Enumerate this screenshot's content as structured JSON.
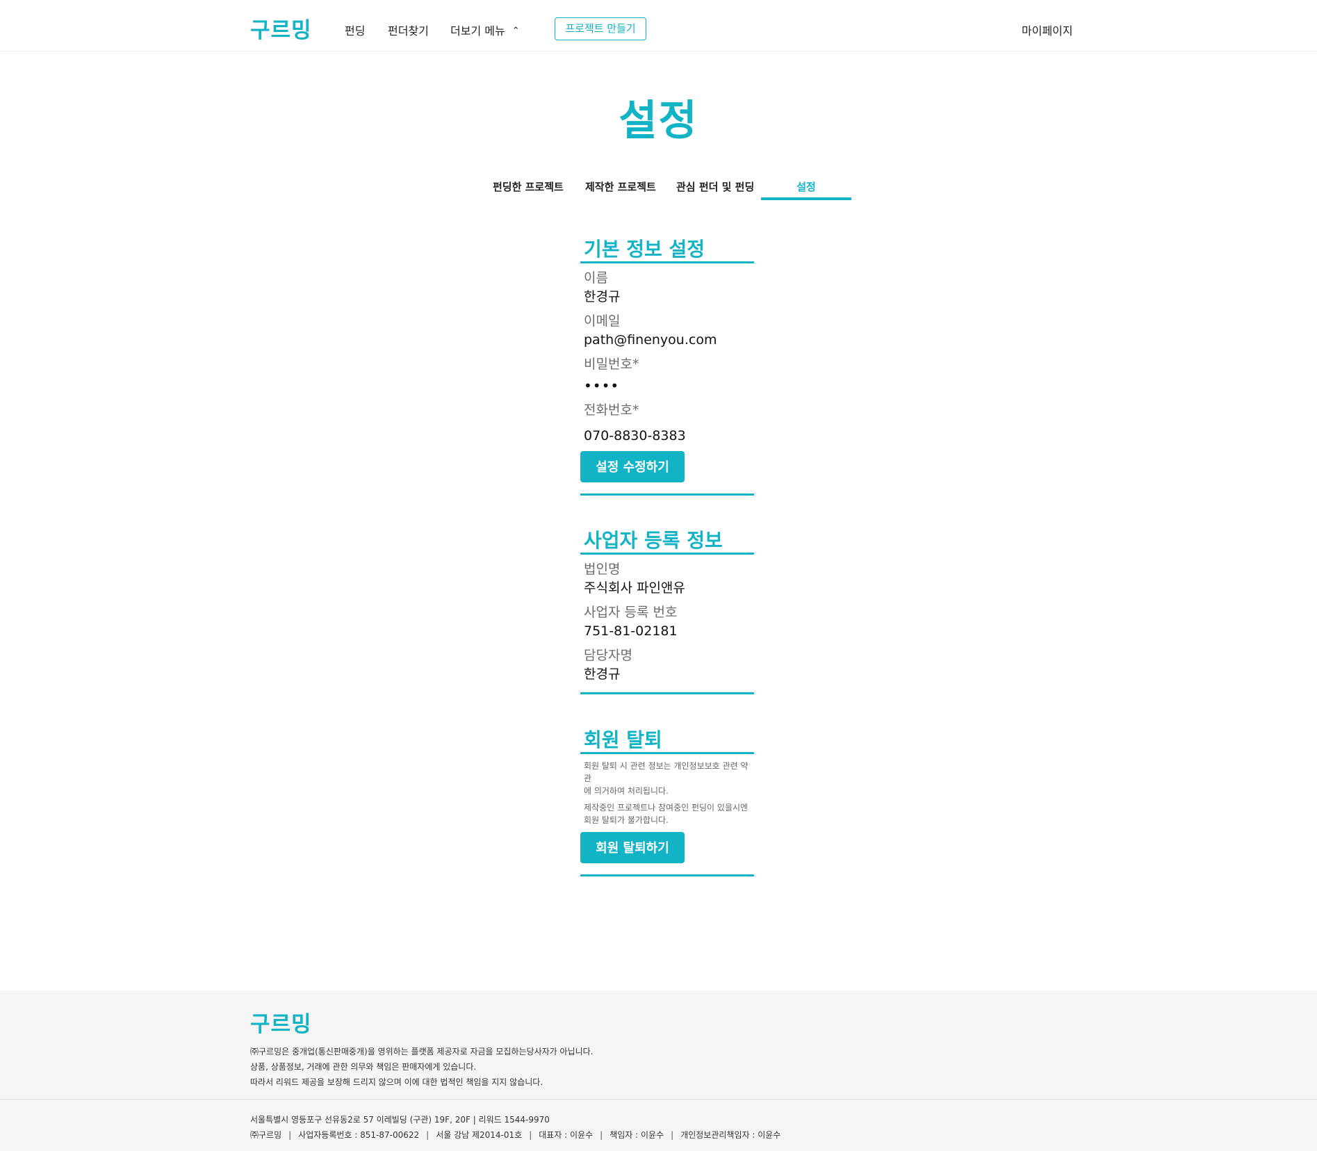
{
  "header": {
    "logo": "구르밍",
    "nav": {
      "funding": "펀딩",
      "funder": "펀더찾기",
      "more": "더보기 메뉴"
    },
    "create_project": "프로젝트 만들기",
    "mypage": "마이페이지"
  },
  "page": {
    "title": "설정",
    "tabs": [
      {
        "label": "펀딩한 프로젝트"
      },
      {
        "label": "제작한 프로젝트"
      },
      {
        "label": "관심 펀더 및 펀딩"
      },
      {
        "label": "설정",
        "active": true
      }
    ]
  },
  "basic_info": {
    "title": "기본 정보 설정",
    "name_label": "이름",
    "name_value": "한경규",
    "email_label": "이메일",
    "email_value": "path@finenyou.com",
    "password_label": "비밀번호*",
    "password_value": "••••",
    "phone_label": "전화번호*",
    "phone_value": "070-8830-8383",
    "submit_label": "설정 수정하기"
  },
  "business_info": {
    "title": "사업자 등록 정보",
    "company_label": "법인명",
    "company_value": "주식회사 파인앤유",
    "reg_no_label": "사업자 등록 번호",
    "reg_no_value": "751-81-02181",
    "manager_label": "담당자명",
    "manager_value": "한경규"
  },
  "withdraw": {
    "title": "회원 탈퇴",
    "notice_1a": "회원 탈퇴 시 관련 정보는 개인정보보호 관련 약관",
    "notice_1b": "에 의거하여 처리됩니다.",
    "notice_2a": "제작중인 프로젝트나 참여중인 펀딩이 있을시엔",
    "notice_2b": "회원 탈퇴가 불가합니다.",
    "button_label": "회원 탈퇴하기"
  },
  "footer": {
    "logo": "구르밍",
    "disclaimer_1": "㈜구르밍은 중개업(통신판매중개)을 영위하는 플랫폼 제공자로 자금을 모집하는당사자가 아닙니다.",
    "disclaimer_2": "상품, 상품정보, 거래에 관한 의무와 책임은 판매자에게 있습니다.",
    "disclaimer_3": "따라서 리워드 제공을 보장해 드리지 않으며 이에 대한 법적인 책임을 지지 않습니다.",
    "address": "서울특별시 영등포구 선유동2로 57 이레빌딩 (구관) 19F, 20F | 리워드 1544-9970",
    "company": "㈜구르밍",
    "biz_reg": "사업자등록번호 : 851-87-00622",
    "telecom": "서울 강남 제2014-01호",
    "ceo": "대표자 : 이윤수",
    "responsible": "책임자 : 이윤수",
    "privacy_officer": "개인정보관리책임자 : 이윤수"
  },
  "colors": {
    "accent": "#13b3c6",
    "footer_bg": "#f5f5f5",
    "label_gray": "#6b6b6b"
  },
  "icons": {
    "more_menu": "chevron-up-icon"
  }
}
